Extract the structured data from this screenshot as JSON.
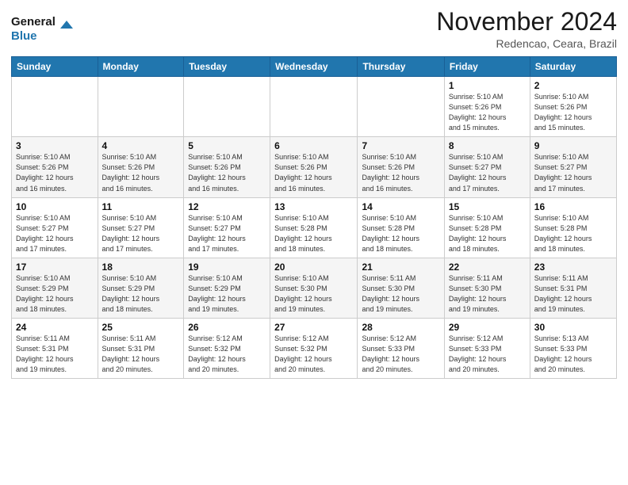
{
  "logo": {
    "line1": "General",
    "line2": "Blue"
  },
  "header": {
    "month": "November 2024",
    "location": "Redencao, Ceara, Brazil"
  },
  "weekdays": [
    "Sunday",
    "Monday",
    "Tuesday",
    "Wednesday",
    "Thursday",
    "Friday",
    "Saturday"
  ],
  "weeks": [
    [
      {
        "day": "",
        "info": ""
      },
      {
        "day": "",
        "info": ""
      },
      {
        "day": "",
        "info": ""
      },
      {
        "day": "",
        "info": ""
      },
      {
        "day": "",
        "info": ""
      },
      {
        "day": "1",
        "info": "Sunrise: 5:10 AM\nSunset: 5:26 PM\nDaylight: 12 hours\nand 15 minutes."
      },
      {
        "day": "2",
        "info": "Sunrise: 5:10 AM\nSunset: 5:26 PM\nDaylight: 12 hours\nand 15 minutes."
      }
    ],
    [
      {
        "day": "3",
        "info": "Sunrise: 5:10 AM\nSunset: 5:26 PM\nDaylight: 12 hours\nand 16 minutes."
      },
      {
        "day": "4",
        "info": "Sunrise: 5:10 AM\nSunset: 5:26 PM\nDaylight: 12 hours\nand 16 minutes."
      },
      {
        "day": "5",
        "info": "Sunrise: 5:10 AM\nSunset: 5:26 PM\nDaylight: 12 hours\nand 16 minutes."
      },
      {
        "day": "6",
        "info": "Sunrise: 5:10 AM\nSunset: 5:26 PM\nDaylight: 12 hours\nand 16 minutes."
      },
      {
        "day": "7",
        "info": "Sunrise: 5:10 AM\nSunset: 5:26 PM\nDaylight: 12 hours\nand 16 minutes."
      },
      {
        "day": "8",
        "info": "Sunrise: 5:10 AM\nSunset: 5:27 PM\nDaylight: 12 hours\nand 17 minutes."
      },
      {
        "day": "9",
        "info": "Sunrise: 5:10 AM\nSunset: 5:27 PM\nDaylight: 12 hours\nand 17 minutes."
      }
    ],
    [
      {
        "day": "10",
        "info": "Sunrise: 5:10 AM\nSunset: 5:27 PM\nDaylight: 12 hours\nand 17 minutes."
      },
      {
        "day": "11",
        "info": "Sunrise: 5:10 AM\nSunset: 5:27 PM\nDaylight: 12 hours\nand 17 minutes."
      },
      {
        "day": "12",
        "info": "Sunrise: 5:10 AM\nSunset: 5:27 PM\nDaylight: 12 hours\nand 17 minutes."
      },
      {
        "day": "13",
        "info": "Sunrise: 5:10 AM\nSunset: 5:28 PM\nDaylight: 12 hours\nand 18 minutes."
      },
      {
        "day": "14",
        "info": "Sunrise: 5:10 AM\nSunset: 5:28 PM\nDaylight: 12 hours\nand 18 minutes."
      },
      {
        "day": "15",
        "info": "Sunrise: 5:10 AM\nSunset: 5:28 PM\nDaylight: 12 hours\nand 18 minutes."
      },
      {
        "day": "16",
        "info": "Sunrise: 5:10 AM\nSunset: 5:28 PM\nDaylight: 12 hours\nand 18 minutes."
      }
    ],
    [
      {
        "day": "17",
        "info": "Sunrise: 5:10 AM\nSunset: 5:29 PM\nDaylight: 12 hours\nand 18 minutes."
      },
      {
        "day": "18",
        "info": "Sunrise: 5:10 AM\nSunset: 5:29 PM\nDaylight: 12 hours\nand 18 minutes."
      },
      {
        "day": "19",
        "info": "Sunrise: 5:10 AM\nSunset: 5:29 PM\nDaylight: 12 hours\nand 19 minutes."
      },
      {
        "day": "20",
        "info": "Sunrise: 5:10 AM\nSunset: 5:30 PM\nDaylight: 12 hours\nand 19 minutes."
      },
      {
        "day": "21",
        "info": "Sunrise: 5:11 AM\nSunset: 5:30 PM\nDaylight: 12 hours\nand 19 minutes."
      },
      {
        "day": "22",
        "info": "Sunrise: 5:11 AM\nSunset: 5:30 PM\nDaylight: 12 hours\nand 19 minutes."
      },
      {
        "day": "23",
        "info": "Sunrise: 5:11 AM\nSunset: 5:31 PM\nDaylight: 12 hours\nand 19 minutes."
      }
    ],
    [
      {
        "day": "24",
        "info": "Sunrise: 5:11 AM\nSunset: 5:31 PM\nDaylight: 12 hours\nand 19 minutes."
      },
      {
        "day": "25",
        "info": "Sunrise: 5:11 AM\nSunset: 5:31 PM\nDaylight: 12 hours\nand 20 minutes."
      },
      {
        "day": "26",
        "info": "Sunrise: 5:12 AM\nSunset: 5:32 PM\nDaylight: 12 hours\nand 20 minutes."
      },
      {
        "day": "27",
        "info": "Sunrise: 5:12 AM\nSunset: 5:32 PM\nDaylight: 12 hours\nand 20 minutes."
      },
      {
        "day": "28",
        "info": "Sunrise: 5:12 AM\nSunset: 5:33 PM\nDaylight: 12 hours\nand 20 minutes."
      },
      {
        "day": "29",
        "info": "Sunrise: 5:12 AM\nSunset: 5:33 PM\nDaylight: 12 hours\nand 20 minutes."
      },
      {
        "day": "30",
        "info": "Sunrise: 5:13 AM\nSunset: 5:33 PM\nDaylight: 12 hours\nand 20 minutes."
      }
    ]
  ]
}
